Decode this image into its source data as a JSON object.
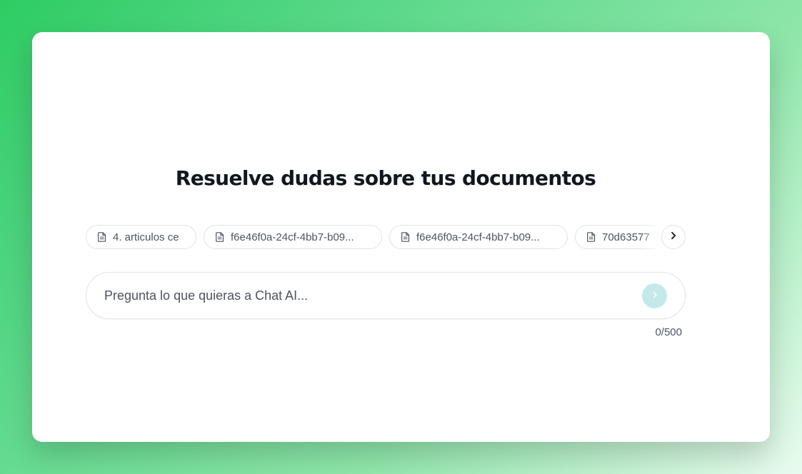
{
  "page": {
    "title": "Resuelve dudas sobre tus documentos"
  },
  "documents": {
    "chips": [
      {
        "label": "4. articulos ce",
        "icon": "document-icon"
      },
      {
        "label": "f6e46f0a-24cf-4bb7-b09...",
        "icon": "document-icon"
      },
      {
        "label": "f6e46f0a-24cf-4bb7-b09...",
        "icon": "document-icon"
      },
      {
        "label": "70d63577",
        "icon": "document-icon"
      }
    ],
    "next_icon": "chevron-right-icon"
  },
  "chat": {
    "placeholder": "Pregunta lo que quieras a Chat AI...",
    "value": "",
    "send_icon": "chevron-right-icon",
    "counter": "0/500"
  },
  "colors": {
    "accent_disabled": "#c4e9e9",
    "background_green": "#2ecc63",
    "title_text": "#0f1720",
    "muted_text": "#4b5563"
  }
}
